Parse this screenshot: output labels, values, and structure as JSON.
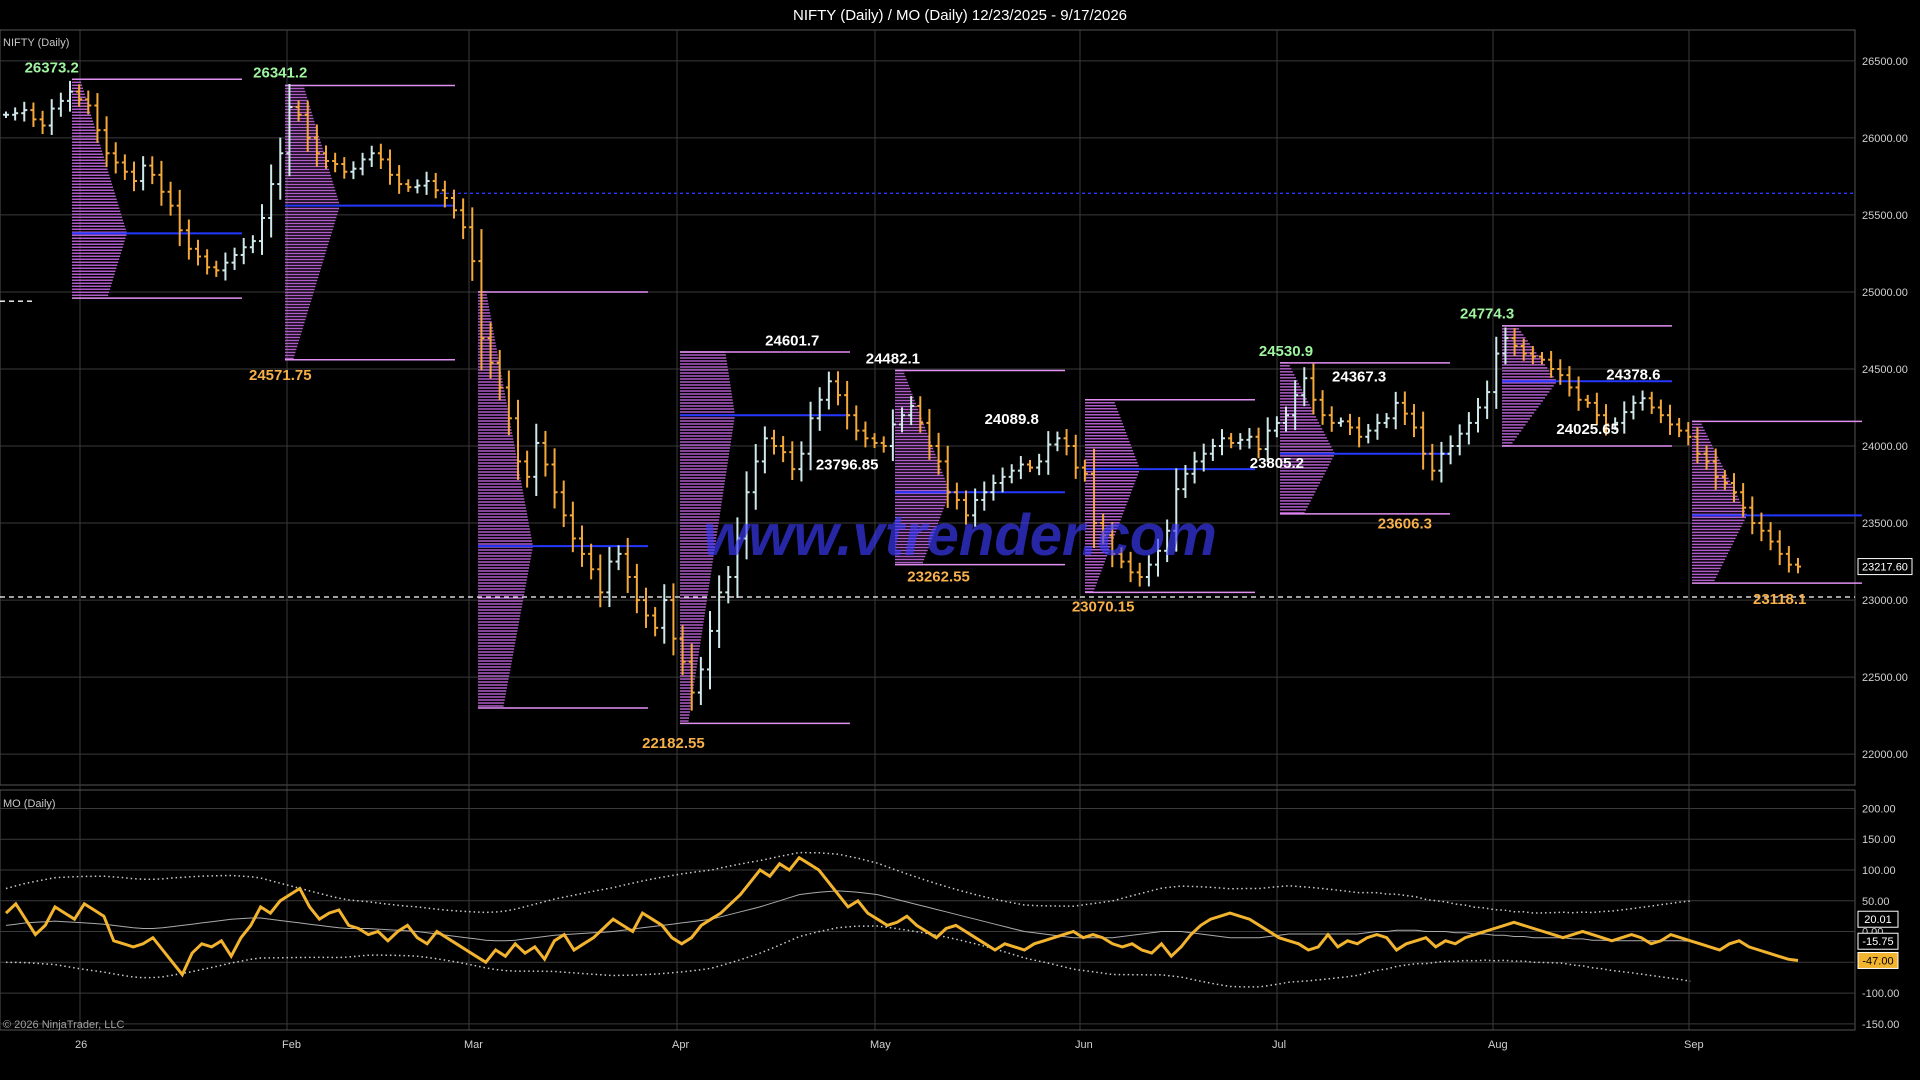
{
  "window": {
    "title": "NIFTY (Daily) / MO (Daily)  12/23/2025 - 9/17/2026"
  },
  "copyright": "© 2026 NinjaTrader, LLC",
  "watermark": "www.vtrender.com",
  "colors": {
    "background": "#000000",
    "grid": "#3a3a3a",
    "up_bar": "#cfe8ea",
    "down_bar": "#f4a83a",
    "profile": "#b05cc8",
    "profile_outline": "#e28ff2",
    "poc_line": "#2438ff",
    "dashed_line": "#ffffff",
    "label_high": "#9ff59f",
    "label_white": "#ffffff",
    "label_low": "#f7b04a",
    "oscillator": "#f2b32e",
    "bands": "#cccccc",
    "watermark": "#3c3cff"
  },
  "chart_data": [
    {
      "type": "line",
      "title": "NIFTY (Daily)",
      "ylim": [
        21800,
        26700
      ],
      "y_ticks": [
        "26500.00",
        "26000.00",
        "25500.00",
        "25000.00",
        "24500.00",
        "24000.00",
        "23500.00",
        "23000.00",
        "22500.00",
        "22000.00"
      ],
      "x_ticks": [
        "26",
        "Feb",
        "Mar",
        "Apr",
        "May",
        "Jun",
        "Jul",
        "Aug",
        "Sep"
      ],
      "last_price": "23217.60",
      "series": [
        {
          "values": [
            26150,
            26160,
            26180,
            26120,
            26080,
            26190,
            26240,
            26300,
            26250,
            26210,
            26050,
            25900,
            25840,
            25780,
            25720,
            25820,
            25760,
            25650,
            25560,
            25400,
            25280,
            25230,
            25160,
            25140,
            25190,
            25240,
            25290,
            25330,
            25480,
            25700,
            25900,
            26200,
            26150,
            26000,
            25900,
            25850,
            25830,
            25780,
            25800,
            25860,
            25900,
            25860,
            25760,
            25700,
            25680,
            25690,
            25720,
            25660,
            25610,
            25530,
            25420,
            25200,
            24700,
            24540,
            24380,
            24180,
            23900,
            23800,
            24020,
            23880,
            23700,
            23550,
            23400,
            23300,
            23200,
            23050,
            23250,
            23300,
            23150,
            23000,
            22900,
            22820,
            23000,
            22750,
            22600,
            22400,
            22550,
            22800,
            23050,
            23150,
            23400,
            23700,
            23900,
            24050,
            24000,
            23960,
            23850,
            23950,
            24180,
            24300,
            24420,
            24330,
            24200,
            24100,
            24050,
            24020,
            24000,
            24140,
            24200,
            24260,
            24150,
            24000,
            23900,
            23700,
            23650,
            23550,
            23650,
            23700,
            23760,
            23800,
            23840,
            23880,
            23860,
            23900,
            24010,
            24050,
            24000,
            23860,
            23820,
            23500,
            23420,
            23300,
            23250,
            23180,
            23150,
            23230,
            23320,
            23450,
            23720,
            23820,
            23900,
            23950,
            24000,
            24050,
            24020,
            24040,
            24060,
            23980,
            24100,
            24150,
            24200,
            24330,
            24440,
            24300,
            24200,
            24150,
            24160,
            24120,
            24060,
            24100,
            24150,
            24180,
            24280,
            24210,
            24120,
            23950,
            23840,
            23950,
            24000,
            24080,
            24150,
            24250,
            24350,
            24600,
            24700,
            24650,
            24600,
            24580,
            24560,
            24500,
            24460,
            24380,
            24300,
            24280,
            24200,
            24140,
            24150,
            24220,
            24280,
            24310,
            24250,
            24200,
            24140,
            24100,
            24060,
            23950,
            23900,
            23800,
            23760,
            23700,
            23600,
            23500,
            23450,
            23380,
            23300,
            23230,
            23217.6
          ]
        }
      ],
      "annotations": [
        {
          "text": "26373.2",
          "role": "high",
          "x_index": 5,
          "y": 26373.2
        },
        {
          "text": "26341.2",
          "role": "high",
          "x_index": 30,
          "y": 26341.2
        },
        {
          "text": "24571.75",
          "role": "low",
          "x_index": 30,
          "y": 24571.75
        },
        {
          "text": "22182.55",
          "role": "low",
          "x_index": 73,
          "y": 22182.55
        },
        {
          "text": "24601.7",
          "role": "white",
          "x_index": 86,
          "y": 24601.7
        },
        {
          "text": "23796.85",
          "role": "white",
          "x_index": 92,
          "y": 23796.85
        },
        {
          "text": "24482.1",
          "role": "white",
          "x_index": 97,
          "y": 24482.1
        },
        {
          "text": "23262.55",
          "role": "low",
          "x_index": 102,
          "y": 23262.55
        },
        {
          "text": "24089.8",
          "role": "white",
          "x_index": 110,
          "y": 24089.8
        },
        {
          "text": "23070.15",
          "role": "low",
          "x_index": 120,
          "y": 23070.15
        },
        {
          "text": "24530.9",
          "role": "high",
          "x_index": 140,
          "y": 24530.9
        },
        {
          "text": "23805.2",
          "role": "white",
          "x_index": 139,
          "y": 23805.2
        },
        {
          "text": "24367.3",
          "role": "white",
          "x_index": 148,
          "y": 24367.3
        },
        {
          "text": "23606.3",
          "role": "low",
          "x_index": 153,
          "y": 23606.3
        },
        {
          "text": "24774.3",
          "role": "high",
          "x_index": 162,
          "y": 24774.3
        },
        {
          "text": "24025.65",
          "role": "white",
          "x_index": 173,
          "y": 24025.65
        },
        {
          "text": "24378.6",
          "role": "white",
          "x_index": 178,
          "y": 24378.6
        },
        {
          "text": "23118.1",
          "role": "low",
          "x_index": 194,
          "y": 23118.1
        }
      ],
      "reference_lines": [
        25640,
        24940,
        23020
      ]
    },
    {
      "type": "line",
      "title": "MO (Daily)",
      "ylim": [
        -160,
        230
      ],
      "y_ticks": [
        "200.00",
        "150.00",
        "100.00",
        "50.00",
        "0.00",
        "-50.00",
        "-100.00",
        "-150.00"
      ],
      "value_badges": [
        "20.01",
        "-15.75",
        "-47.00"
      ],
      "series": [
        {
          "name": "MO",
          "values": [
            30,
            45,
            20,
            -5,
            10,
            40,
            30,
            20,
            45,
            35,
            25,
            -15,
            -20,
            -25,
            -20,
            -10,
            -30,
            -50,
            -70,
            -35,
            -20,
            -25,
            -15,
            -40,
            -10,
            10,
            40,
            30,
            50,
            60,
            70,
            40,
            20,
            30,
            35,
            10,
            5,
            -5,
            0,
            -15,
            0,
            10,
            -10,
            -20,
            0,
            -10,
            -20,
            -30,
            -40,
            -50,
            -30,
            -40,
            -20,
            -35,
            -25,
            -45,
            -15,
            -5,
            -30,
            -20,
            -10,
            5,
            20,
            10,
            0,
            30,
            20,
            10,
            -10,
            -20,
            -10,
            10,
            20,
            30,
            45,
            60,
            80,
            100,
            90,
            110,
            100,
            120,
            110,
            100,
            80,
            60,
            40,
            50,
            30,
            20,
            10,
            15,
            25,
            10,
            0,
            -10,
            5,
            10,
            0,
            -10,
            -20,
            -30,
            -20,
            -25,
            -30,
            -20,
            -15,
            -10,
            -5,
            0,
            -10,
            -5,
            -10,
            -20,
            -25,
            -20,
            -30,
            -35,
            -20,
            -40,
            -25,
            -5,
            10,
            20,
            25,
            30,
            25,
            20,
            10,
            0,
            -10,
            -15,
            -20,
            -30,
            -25,
            -5,
            -25,
            -15,
            -20,
            -10,
            -5,
            -10,
            -30,
            -20,
            -15,
            -10,
            -25,
            -15,
            -20,
            -10,
            -5,
            0,
            5,
            10,
            15,
            10,
            5,
            0,
            -5,
            -10,
            -5,
            0,
            -5,
            -10,
            -15,
            -10,
            -5,
            -10,
            -20,
            -15,
            -5,
            -10,
            -15,
            -20,
            -25,
            -30,
            -20,
            -15,
            -25,
            -30,
            -35,
            -40,
            -45,
            -47
          ]
        },
        {
          "name": "MA",
          "values": [
            10,
            12,
            14,
            15,
            16,
            17,
            16,
            15,
            14,
            13,
            12,
            10,
            8,
            6,
            5,
            5,
            6,
            8,
            10,
            12,
            14,
            16,
            18,
            20,
            21,
            22,
            22,
            20,
            18,
            16,
            14,
            12,
            10,
            8,
            6,
            5,
            5,
            5,
            4,
            3,
            2,
            1,
            0,
            -2,
            -4,
            -6,
            -8,
            -10,
            -12,
            -14,
            -15,
            -15,
            -14,
            -12,
            -10,
            -8,
            -6,
            -5,
            -4,
            -3,
            -2,
            -1,
            0,
            2,
            4,
            6,
            8,
            10,
            12,
            14,
            16,
            18,
            20,
            24,
            28,
            32,
            36,
            40,
            45,
            50,
            55,
            60,
            62,
            64,
            65,
            66,
            65,
            64,
            62,
            60,
            56,
            52,
            48,
            44,
            40,
            36,
            32,
            28,
            24,
            20,
            16,
            12,
            8,
            4,
            0,
            -2,
            -4,
            -6,
            -8,
            -10,
            -10,
            -10,
            -10,
            -10,
            -8,
            -6,
            -4,
            -2,
            0,
            0,
            0,
            -2,
            -4,
            -6,
            -8,
            -10,
            -10,
            -10,
            -10,
            -8,
            -6,
            -4,
            -4,
            -4,
            -4,
            -4,
            -4,
            -4,
            -4,
            -2,
            0,
            0,
            2,
            2,
            2,
            0,
            0,
            0,
            -2,
            -2,
            -4,
            -4,
            -6,
            -6,
            -8,
            -8,
            -10,
            -10,
            -10,
            -10,
            -12,
            -12,
            -14,
            -14,
            -15,
            -15,
            -15,
            -15,
            -15,
            -15,
            -15,
            -15,
            -15.75
          ]
        }
      ]
    }
  ]
}
